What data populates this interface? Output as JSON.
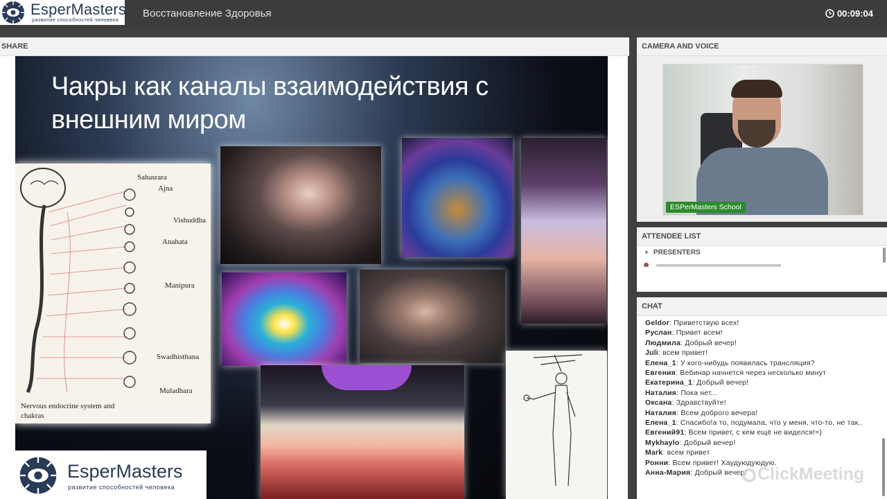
{
  "app": {
    "logo_name": "EsperMasters",
    "logo_tagline": "развитие способностей человека",
    "meeting_title": "Восстановление Здоровья",
    "timer": "00:09:04",
    "brand_color": "#2a3b58"
  },
  "share": {
    "header": "SHARE",
    "slide": {
      "title": "Чакры как каналы взаимодействия с внешним миром",
      "chakra_labels": [
        "Sahasrara",
        "Ajna",
        "Vishuddha",
        "Anahata",
        "Manipura",
        "Swadhisthana",
        "Muladhara"
      ],
      "caption": "Nervous endocrine system and chakras",
      "logo_name": "EsperMasters",
      "logo_tagline": "развитие способностей человека"
    }
  },
  "camera": {
    "header": "CAMERA AND VOICE",
    "label": "ESPerMasters School",
    "label_color": "#2a8d2a"
  },
  "attendees": {
    "header": "ATTENDEE LIST",
    "group": "PRESENTERS"
  },
  "chat": {
    "header": "CHAT",
    "messages": [
      {
        "author": "Geldor",
        "text": "Приветствую всех!"
      },
      {
        "author": "Руслан",
        "text": "Привет всем!"
      },
      {
        "author": "Людмила",
        "text": "Добрый вечер!"
      },
      {
        "author": "Juli",
        "text": "всем привет!"
      },
      {
        "author": "Елена_1",
        "text": "У кого-нибудь появилась трансляция?"
      },
      {
        "author": "Евгения",
        "text": "Вебинар начнется через несколько минут"
      },
      {
        "author": "Екатерина_1",
        "text": "Добрый вечер!"
      },
      {
        "author": "Наталия",
        "text": "Пока нет..."
      },
      {
        "author": "Оксана",
        "text": "Здравствуйте!"
      },
      {
        "author": "Наталия",
        "text": "Всем доброго вечера!"
      },
      {
        "author": "Елена_1",
        "text": "Спасибо!а то, подумала, что у меня, что-то, не так.."
      },
      {
        "author": "Евгений91",
        "text": "Всем привет, с кем ещё не виделся!=)"
      },
      {
        "author": "Mykhaylo",
        "text": "Добрый вечер!"
      },
      {
        "author": "Mark",
        "text": "всем привет"
      },
      {
        "author": "Ронни",
        "text": "Всем привет! Хаудуюдуюдую."
      },
      {
        "author": "Анна-Мария",
        "text": "Добрый вечер!"
      }
    ],
    "watermark": "ClickMeeting"
  }
}
